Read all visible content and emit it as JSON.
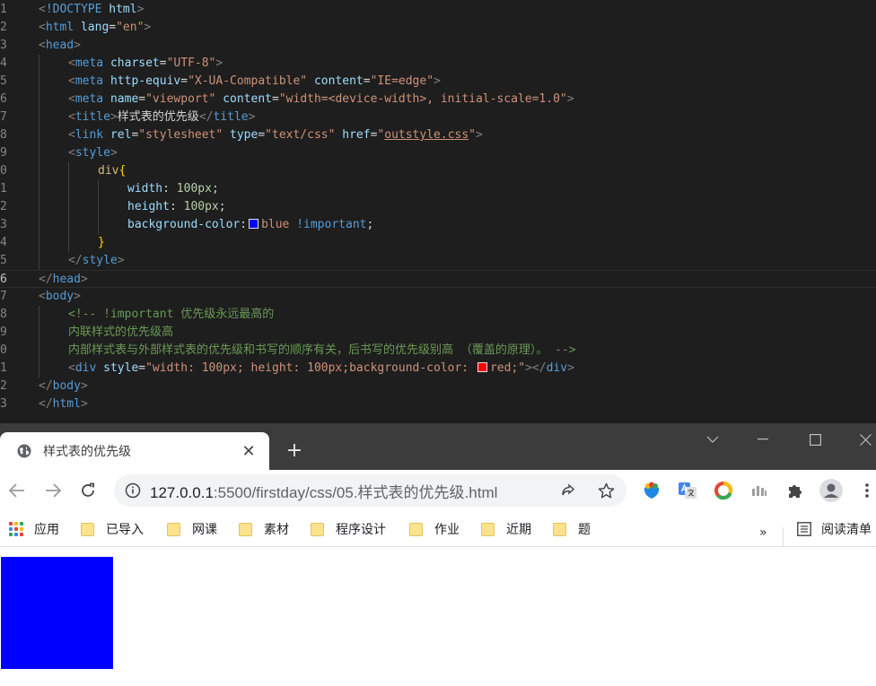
{
  "editor": {
    "active_line": 16,
    "lines": [
      {
        "n": "1",
        "indent": 0,
        "tokens": [
          [
            "brk",
            "<"
          ],
          [
            "kw",
            "!DOCTYPE"
          ],
          [
            "txt",
            " "
          ],
          [
            "attr",
            "html"
          ],
          [
            "brk",
            ">"
          ]
        ]
      },
      {
        "n": "2",
        "indent": 0,
        "tokens": [
          [
            "brk",
            "<"
          ],
          [
            "tag",
            "html"
          ],
          [
            "txt",
            " "
          ],
          [
            "attr",
            "lang"
          ],
          [
            "txt",
            "="
          ],
          [
            "str",
            "\"en\""
          ],
          [
            "brk",
            ">"
          ]
        ]
      },
      {
        "n": "3",
        "indent": 0,
        "tokens": [
          [
            "brk",
            "<"
          ],
          [
            "tag",
            "head"
          ],
          [
            "brk",
            ">"
          ]
        ]
      },
      {
        "n": "4",
        "indent": 1,
        "tokens": [
          [
            "brk",
            "<"
          ],
          [
            "tag",
            "meta"
          ],
          [
            "txt",
            " "
          ],
          [
            "attr",
            "charset"
          ],
          [
            "txt",
            "="
          ],
          [
            "str",
            "\"UTF-8\""
          ],
          [
            "brk",
            ">"
          ]
        ]
      },
      {
        "n": "5",
        "indent": 1,
        "tokens": [
          [
            "brk",
            "<"
          ],
          [
            "tag",
            "meta"
          ],
          [
            "txt",
            " "
          ],
          [
            "attr",
            "http-equiv"
          ],
          [
            "txt",
            "="
          ],
          [
            "str",
            "\"X-UA-Compatible\""
          ],
          [
            "txt",
            " "
          ],
          [
            "attr",
            "content"
          ],
          [
            "txt",
            "="
          ],
          [
            "str",
            "\"IE=edge\""
          ],
          [
            "brk",
            ">"
          ]
        ]
      },
      {
        "n": "6",
        "indent": 1,
        "tokens": [
          [
            "brk",
            "<"
          ],
          [
            "tag",
            "meta"
          ],
          [
            "txt",
            " "
          ],
          [
            "attr",
            "name"
          ],
          [
            "txt",
            "="
          ],
          [
            "str",
            "\"viewport\""
          ],
          [
            "txt",
            " "
          ],
          [
            "attr",
            "content"
          ],
          [
            "txt",
            "="
          ],
          [
            "str",
            "\"width=<device-width>, initial-scale=1.0\""
          ],
          [
            "brk",
            ">"
          ]
        ]
      },
      {
        "n": "7",
        "indent": 1,
        "tokens": [
          [
            "brk",
            "<"
          ],
          [
            "tag",
            "title"
          ],
          [
            "brk",
            ">"
          ],
          [
            "txt",
            "样式表的优先级"
          ],
          [
            "brk",
            "</"
          ],
          [
            "tag",
            "title"
          ],
          [
            "brk",
            ">"
          ]
        ]
      },
      {
        "n": "8",
        "indent": 1,
        "tokens": [
          [
            "brk",
            "<"
          ],
          [
            "tag",
            "link"
          ],
          [
            "txt",
            " "
          ],
          [
            "attr",
            "rel"
          ],
          [
            "txt",
            "="
          ],
          [
            "str",
            "\"stylesheet\""
          ],
          [
            "txt",
            " "
          ],
          [
            "attr",
            "type"
          ],
          [
            "txt",
            "="
          ],
          [
            "str",
            "\"text/css\""
          ],
          [
            "txt",
            " "
          ],
          [
            "attr",
            "href"
          ],
          [
            "txt",
            "="
          ],
          [
            "str",
            "\""
          ],
          [
            "link",
            "outstyle.css"
          ],
          [
            "str",
            "\""
          ],
          [
            "brk",
            ">"
          ]
        ]
      },
      {
        "n": "9",
        "indent": 1,
        "tokens": [
          [
            "brk",
            "<"
          ],
          [
            "tag",
            "style"
          ],
          [
            "brk",
            ">"
          ]
        ]
      },
      {
        "n": "0",
        "indent": 2,
        "tokens": [
          [
            "sel",
            "div"
          ],
          [
            "brace",
            "{"
          ]
        ]
      },
      {
        "n": "1",
        "indent": 3,
        "tokens": [
          [
            "prop",
            "width"
          ],
          [
            "txt",
            ": "
          ],
          [
            "num",
            "100px"
          ],
          [
            "txt",
            ";"
          ]
        ]
      },
      {
        "n": "2",
        "indent": 3,
        "tokens": [
          [
            "prop",
            "height"
          ],
          [
            "txt",
            ": "
          ],
          [
            "num",
            "100px"
          ],
          [
            "txt",
            ";"
          ]
        ]
      },
      {
        "n": "3",
        "indent": 3,
        "tokens": [
          [
            "prop",
            "background-color"
          ],
          [
            "txt",
            ":"
          ],
          [
            "swatch",
            "#0000ff"
          ],
          [
            "str",
            "blue"
          ],
          [
            "txt",
            " "
          ],
          [
            "kw",
            "!important"
          ],
          [
            "txt",
            ";"
          ]
        ]
      },
      {
        "n": "4",
        "indent": 2,
        "tokens": [
          [
            "brace",
            "}"
          ]
        ]
      },
      {
        "n": "5",
        "indent": 1,
        "tokens": [
          [
            "brk",
            "</"
          ],
          [
            "tag",
            "style"
          ],
          [
            "brk",
            ">"
          ]
        ]
      },
      {
        "n": "6",
        "indent": 0,
        "tokens": [
          [
            "brk",
            "</"
          ],
          [
            "tag",
            "head"
          ],
          [
            "brk",
            ">"
          ]
        ]
      },
      {
        "n": "7",
        "indent": 0,
        "tokens": [
          [
            "brk",
            "<"
          ],
          [
            "tag",
            "body"
          ],
          [
            "brk",
            ">"
          ]
        ]
      },
      {
        "n": "8",
        "indent": 1,
        "tokens": [
          [
            "cmt",
            "<!-- !important 优先级永远最高的"
          ]
        ]
      },
      {
        "n": "9",
        "indent": 1,
        "tokens": [
          [
            "cmt",
            "内联样式的优先级高"
          ]
        ]
      },
      {
        "n": "0",
        "indent": 1,
        "tokens": [
          [
            "cmt",
            "内部样式表与外部样式表的优先级和书写的顺序有关，后书写的优先级别高 （覆盖的原理）。 -->"
          ]
        ]
      },
      {
        "n": "1",
        "indent": 1,
        "tokens": [
          [
            "brk",
            "<"
          ],
          [
            "tag",
            "div"
          ],
          [
            "txt",
            " "
          ],
          [
            "attr",
            "style"
          ],
          [
            "txt",
            "="
          ],
          [
            "str",
            "\"width: 100px; height: 100px;background-color: "
          ],
          [
            "swatch",
            "#ff0000"
          ],
          [
            "str",
            "red;\""
          ],
          [
            "brk",
            "></"
          ],
          [
            "tag",
            "div"
          ],
          [
            "brk",
            ">"
          ]
        ]
      },
      {
        "n": "2",
        "indent": 0,
        "tokens": [
          [
            "brk",
            "</"
          ],
          [
            "tag",
            "body"
          ],
          [
            "brk",
            ">"
          ]
        ]
      },
      {
        "n": "3",
        "indent": 0,
        "tokens": [
          [
            "brk",
            "</"
          ],
          [
            "tag",
            "html"
          ],
          [
            "brk",
            ">"
          ]
        ]
      }
    ]
  },
  "browser": {
    "tab_title": "样式表的优先级",
    "tab_close": "✕",
    "new_tab": "+",
    "url_host": "127.0.0.1",
    "url_rest": ":5500/firstday/css/05.样式表的优先级.html",
    "bookmarks": [
      {
        "label": "应用",
        "icon": "apps-grid-icon"
      },
      {
        "label": "已导入",
        "icon": "folder-icon"
      },
      {
        "label": "网课",
        "icon": "folder-icon"
      },
      {
        "label": "素材",
        "icon": "folder-icon"
      },
      {
        "label": "程序设计",
        "icon": "folder-icon"
      },
      {
        "label": "作业",
        "icon": "folder-icon"
      },
      {
        "label": "近期",
        "icon": "folder-icon"
      },
      {
        "label": "题",
        "icon": "folder-icon"
      }
    ],
    "bookmarks_more": "»",
    "reading_list": "阅读清单"
  },
  "page": {
    "div_color": "#0000ff"
  }
}
